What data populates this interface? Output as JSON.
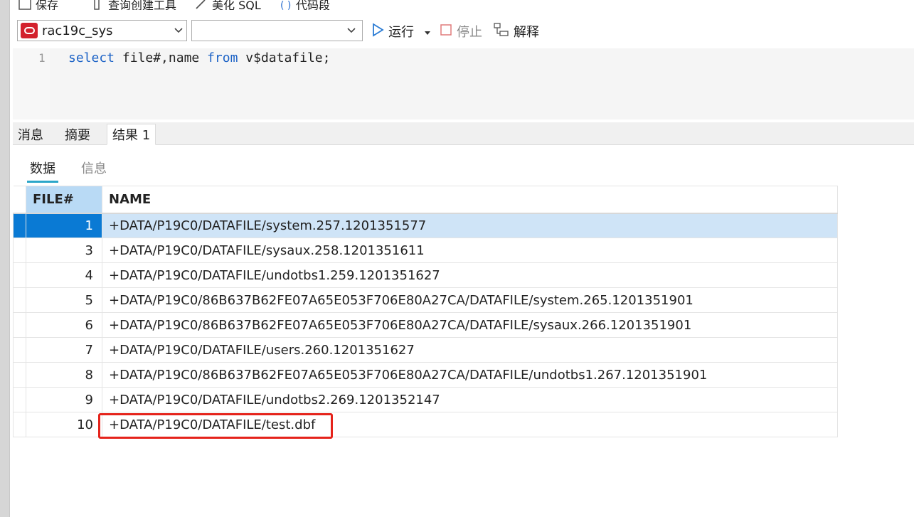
{
  "top_toolbar": {
    "save_label": "保存",
    "query_builder_label": "查询创建工具",
    "beautify_label": "美化 SQL",
    "snippet_label": "代码段"
  },
  "toolbar": {
    "connection_value": "rac19c_sys",
    "database_value": "",
    "run_label": "运行",
    "stop_label": "停止",
    "explain_label": "解释"
  },
  "editor": {
    "line_number": "1",
    "code": {
      "kw1": "select",
      "t1": " file#,name ",
      "kw2": "from",
      "t2": " v$datafile;"
    }
  },
  "result_tabs": [
    "消息",
    "摘要",
    "结果 1"
  ],
  "sub_tabs": [
    "数据",
    "信息"
  ],
  "grid": {
    "columns": [
      "FILE#",
      "NAME"
    ],
    "rows": [
      {
        "file": "1",
        "name": "+DATA/P19C0/DATAFILE/system.257.1201351577"
      },
      {
        "file": "3",
        "name": "+DATA/P19C0/DATAFILE/sysaux.258.1201351611"
      },
      {
        "file": "4",
        "name": "+DATA/P19C0/DATAFILE/undotbs1.259.1201351627"
      },
      {
        "file": "5",
        "name": "+DATA/P19C0/86B637B62FE07A65E053F706E80A27CA/DATAFILE/system.265.1201351901"
      },
      {
        "file": "6",
        "name": "+DATA/P19C0/86B637B62FE07A65E053F706E80A27CA/DATAFILE/sysaux.266.1201351901"
      },
      {
        "file": "7",
        "name": "+DATA/P19C0/DATAFILE/users.260.1201351627"
      },
      {
        "file": "8",
        "name": "+DATA/P19C0/86B637B62FE07A65E053F706E80A27CA/DATAFILE/undotbs1.267.1201351901"
      },
      {
        "file": "9",
        "name": "+DATA/P19C0/DATAFILE/undotbs2.269.1201352147"
      },
      {
        "file": "10",
        "name": "+DATA/P19C0/DATAFILE/test.dbf"
      }
    ]
  },
  "colors": {
    "keyword": "#1d63c6",
    "selection": "#0a7ad4",
    "highlight_box": "#e5231b",
    "oracle_brand": "#d3212d"
  }
}
